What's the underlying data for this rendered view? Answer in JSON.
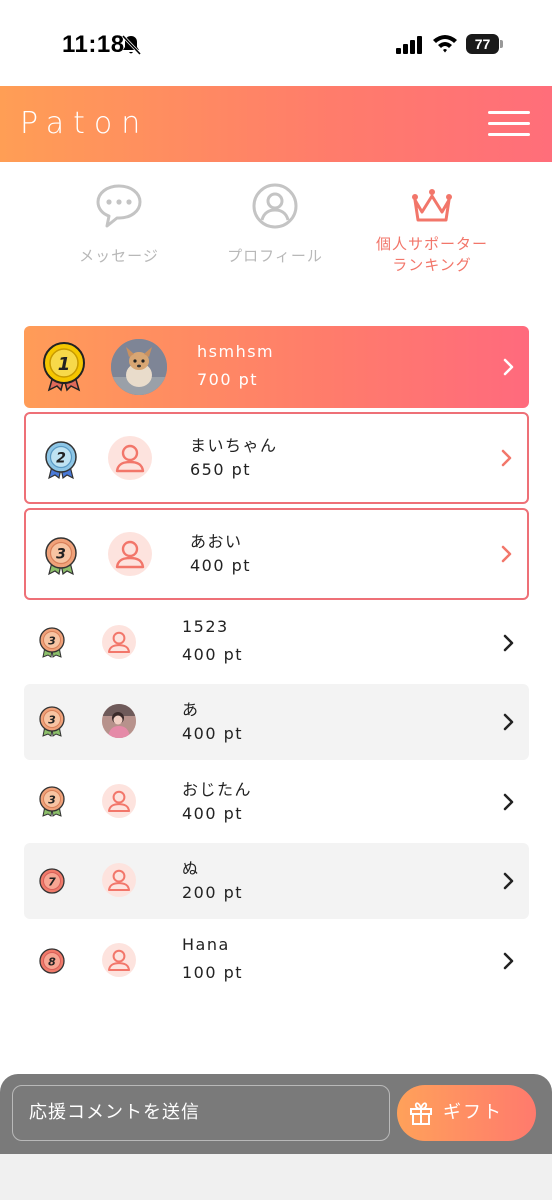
{
  "status_bar": {
    "time": "11:18",
    "battery": "77"
  },
  "header": {
    "logo": "Paton"
  },
  "tabs": [
    {
      "id": "messages",
      "label": "メッセージ",
      "icon": "chat-bubble-icon",
      "active": false
    },
    {
      "id": "profile",
      "label": "プロフィール",
      "icon": "profile-icon",
      "active": false
    },
    {
      "id": "ranking",
      "label_line1": "個人サポーター",
      "label_line2": "ランキング",
      "icon": "crown-icon",
      "active": true
    }
  ],
  "ranking": [
    {
      "rank": "1",
      "name": "hsmhsm",
      "points": "700 pt",
      "avatar": "dog-photo"
    },
    {
      "rank": "2",
      "name": "まいちゃん",
      "points": "650 pt",
      "avatar": "default-user-icon"
    },
    {
      "rank": "3",
      "name": "あおい",
      "points": "400 pt",
      "avatar": "default-user-icon"
    },
    {
      "rank": "3",
      "name": "1523",
      "points": "400 pt",
      "avatar": "default-user-icon"
    },
    {
      "rank": "3",
      "name": "あ",
      "points": "400 pt",
      "avatar": "person-photo"
    },
    {
      "rank": "3",
      "name": "おじたん",
      "points": "400 pt",
      "avatar": "default-user-icon"
    },
    {
      "rank": "7",
      "name": "ぬ",
      "points": "200 pt",
      "avatar": "default-user-icon"
    },
    {
      "rank": "8",
      "name": "Hana",
      "points": "100 pt",
      "avatar": "default-user-icon"
    }
  ],
  "bottom_bar": {
    "comment_placeholder": "応援コメントを送信",
    "gift_label": "ギフト"
  },
  "colors": {
    "accent": "#f2766a",
    "gradient_start": "#ff9e55",
    "gradient_end": "#ff6e7a",
    "gold": "#f2c200",
    "silver_blue": "#6aa7e0",
    "bronze": "#f0a27a"
  }
}
